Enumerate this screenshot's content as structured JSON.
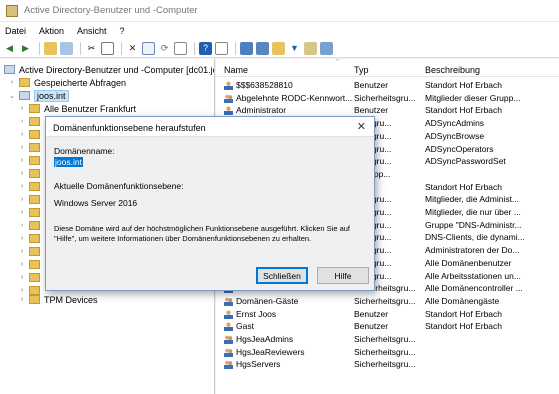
{
  "window": {
    "title": "Active Directory-Benutzer und -Computer"
  },
  "menu": [
    "Datei",
    "Aktion",
    "Ansicht",
    "?"
  ],
  "tree": {
    "root": "Active Directory-Benutzer und -Computer [dc01.joo",
    "saved_queries": "Gespeicherte Abfragen",
    "domain": "joos.int",
    "first_ou": "Alle Benutzer Frankfurt",
    "last_ou": "TPM Devices"
  },
  "list": {
    "columns": {
      "name": "Name",
      "type": "Typ",
      "desc": "Beschreibung"
    },
    "rows": [
      {
        "name": "$$$638528810",
        "type": "Benutzer",
        "desc": "Standort Hof Erbach",
        "icon": "user"
      },
      {
        "name": "Abgelehnte RODC-Kennwort...",
        "type": "Sicherheitsgru...",
        "desc": "Mitglieder dieser Grupp...",
        "icon": "group"
      },
      {
        "name": "Administrator",
        "type": "Benutzer",
        "desc": "Standort Hof Erbach",
        "icon": "user"
      },
      {
        "name": "",
        "type": "heitsgru...",
        "desc": "ADSyncAdmins",
        "icon": ""
      },
      {
        "name": "",
        "type": "heitsgru...",
        "desc": "ADSyncBrowse",
        "icon": ""
      },
      {
        "name": "",
        "type": "heitsgru...",
        "desc": "ADSyncOperators",
        "icon": ""
      },
      {
        "name": "",
        "type": "heitsgru...",
        "desc": "ADSyncPasswordSet",
        "icon": ""
      },
      {
        "name": "",
        "type": "ergrupp...",
        "desc": "",
        "icon": ""
      },
      {
        "name": "",
        "type": "tzer",
        "desc": "Standort Hof Erbach",
        "icon": ""
      },
      {
        "name": "",
        "type": "heitsgru...",
        "desc": "Mitglieder, die Administ...",
        "icon": ""
      },
      {
        "name": "",
        "type": "heitsgru...",
        "desc": "Mitglieder, die nur über ...",
        "icon": ""
      },
      {
        "name": "",
        "type": "heitsgru...",
        "desc": "Gruppe \"DNS-Administr...",
        "icon": ""
      },
      {
        "name": "",
        "type": "heitsgru...",
        "desc": "DNS-Clients, die dynami...",
        "icon": ""
      },
      {
        "name": "",
        "type": "heitsgru...",
        "desc": "Administratoren der Do...",
        "icon": ""
      },
      {
        "name": "",
        "type": "heitsgru...",
        "desc": "Alle Domänenbenutzer",
        "icon": ""
      },
      {
        "name": "",
        "type": "heitsgru...",
        "desc": "Alle Arbeitsstationen un...",
        "icon": ""
      },
      {
        "name": "Domänencontroller",
        "type": "Sicherheitsgru...",
        "desc": "Alle Domänencontroller ...",
        "icon": "group"
      },
      {
        "name": "Domänen-Gäste",
        "type": "Sicherheitsgru...",
        "desc": "Alle Domänengäste",
        "icon": "group"
      },
      {
        "name": "Ernst Joos",
        "type": "Benutzer",
        "desc": "Standort Hof Erbach",
        "icon": "user"
      },
      {
        "name": "Gast",
        "type": "Benutzer",
        "desc": "Standort Hof Erbach",
        "icon": "user"
      },
      {
        "name": "HgsJeaAdmins",
        "type": "Sicherheitsgru...",
        "desc": "",
        "icon": "group"
      },
      {
        "name": "HgsJeaReviewers",
        "type": "Sicherheitsgru...",
        "desc": "",
        "icon": "group"
      },
      {
        "name": "HgsServers",
        "type": "Sicherheitsgru...",
        "desc": "",
        "icon": "group"
      }
    ]
  },
  "dialog": {
    "title": "Domänenfunktionsebene heraufstufen",
    "close_glyph": "✕",
    "domain_label": "Domänenname:",
    "domain_value": "joos.int",
    "level_label": "Aktuelle Domänenfunktionsebene:",
    "level_value": "Windows Server 2016",
    "info": "Diese Domäne wird auf der höchstmöglichen Funktionsebene ausgeführt. Klicken Sie auf \"Hilfe\", um weitere Informationen über Domänenfunktionsebenen zu erhalten.",
    "close_button": "Schließen",
    "help_button": "Hilfe"
  }
}
